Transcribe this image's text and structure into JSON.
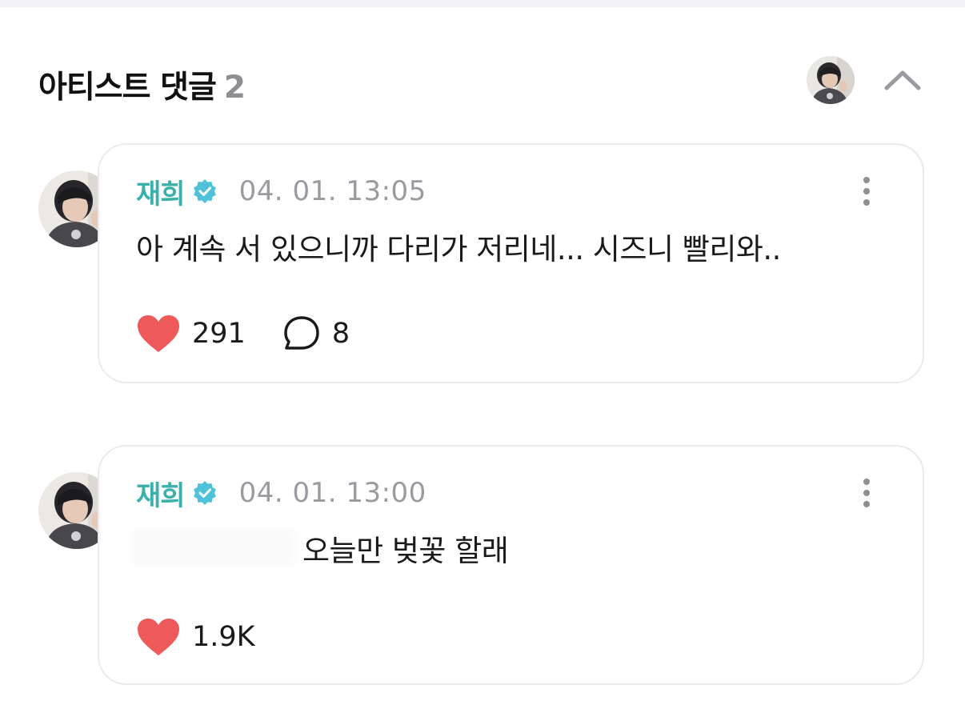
{
  "section": {
    "title": "아티스트 댓글",
    "count": "2"
  },
  "icons": {
    "header_avatar": "profile-photo",
    "collapse": "chevron-up-icon",
    "verified": "verified-badge-icon",
    "more": "more-vertical-icon",
    "like": "heart-icon",
    "reply": "speech-bubble-icon"
  },
  "colors": {
    "author": "#3bb1ab",
    "heart": "#ee5a5a",
    "timestamp": "#9a9aa0",
    "count_muted": "#8e8e93"
  },
  "comments": [
    {
      "author": "재희",
      "timestamp": "04. 01. 13:05",
      "text": "아 계속 서 있으니까 다리가 저리네... 시즈니 빨리와..",
      "likes": "291",
      "replies": "8"
    },
    {
      "author": "재희",
      "timestamp": "04. 01. 13:00",
      "text": "오늘만 벚꽃 할래",
      "likes": "1.9K"
    }
  ]
}
